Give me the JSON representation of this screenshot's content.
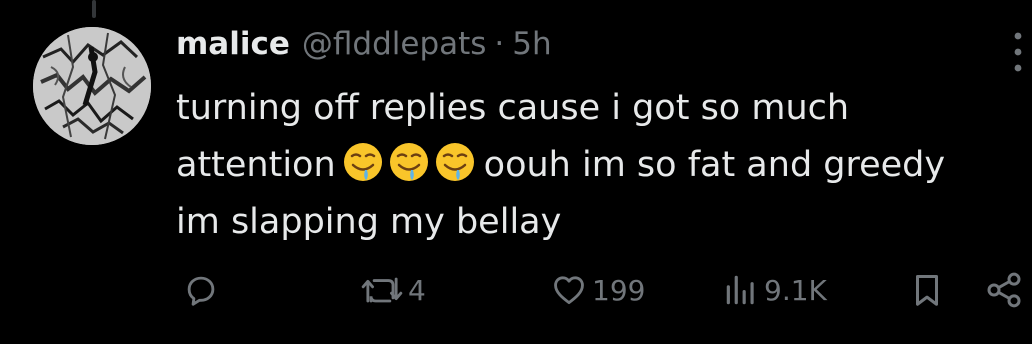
{
  "tweet": {
    "display_name": "malice",
    "handle": "@flddlepats",
    "separator": "·",
    "time": "5h",
    "text_lines": [
      "turning off replies cause i got so much",
      "attention",
      "oouh im so fat and greedy",
      "im slapping my bellay"
    ],
    "inline_emoji": [
      "drooling-face-emoji",
      "drooling-face-emoji",
      "drooling-face-emoji"
    ]
  },
  "actions": {
    "reply": {
      "icon": "reply-icon",
      "count": ""
    },
    "retweet": {
      "icon": "retweet-icon",
      "count": "4"
    },
    "like": {
      "icon": "heart-icon",
      "count": "199"
    },
    "views": {
      "icon": "views-bar-chart-icon",
      "count": "9.1K"
    },
    "bookmark": {
      "icon": "bookmark-icon"
    },
    "share": {
      "icon": "share-icon"
    }
  },
  "colors": {
    "background": "#000000",
    "primary_text": "#e7e9ea",
    "secondary_text": "#71767b",
    "thread_line": "#333639"
  }
}
